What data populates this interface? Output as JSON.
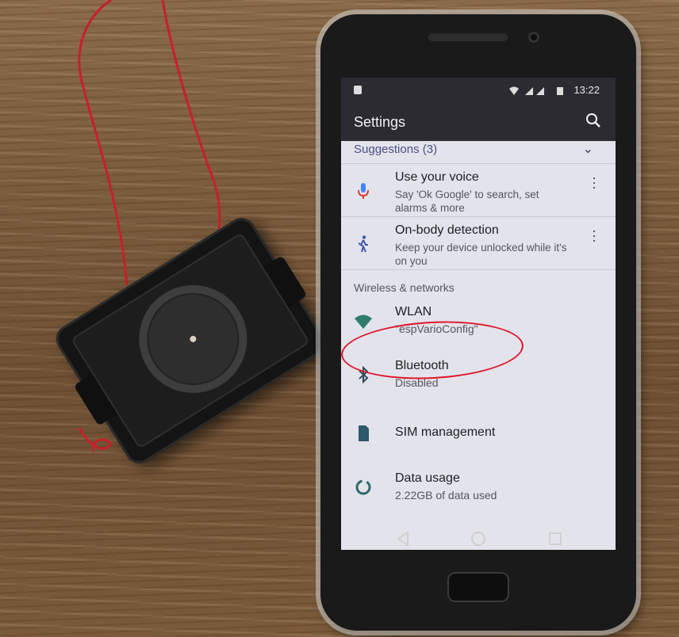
{
  "status_bar": {
    "time": "13:22",
    "icons": [
      "notification-icon",
      "wifi-icon",
      "cellular-icon",
      "battery-icon"
    ]
  },
  "app_bar": {
    "title": "Settings",
    "search_icon": "search-icon"
  },
  "suggestions": {
    "header": "Suggestions (3)",
    "items": [
      {
        "title": "Use your voice",
        "subtitle": "Say 'Ok Google' to search, set alarms & more",
        "icon": "microphone-icon"
      },
      {
        "title": "On-body detection",
        "subtitle": "Keep your device unlocked while it's on you",
        "icon": "walking-person-icon"
      }
    ]
  },
  "wireless": {
    "header": "Wireless & networks",
    "items": [
      {
        "title": "WLAN",
        "subtitle": "\"espVarioConfig\"",
        "icon": "wifi-icon"
      },
      {
        "title": "Bluetooth",
        "subtitle": "Disabled",
        "icon": "bluetooth-icon"
      },
      {
        "title": "SIM management",
        "subtitle": "",
        "icon": "sim-card-icon"
      },
      {
        "title": "Data usage",
        "subtitle": "2.22GB of data used",
        "icon": "data-usage-icon"
      }
    ]
  },
  "colors": {
    "screen_bg": "#e3e3ec",
    "app_bar": "#2b2b31",
    "accent": "#4a4f85",
    "highlight": "#e0162b"
  }
}
